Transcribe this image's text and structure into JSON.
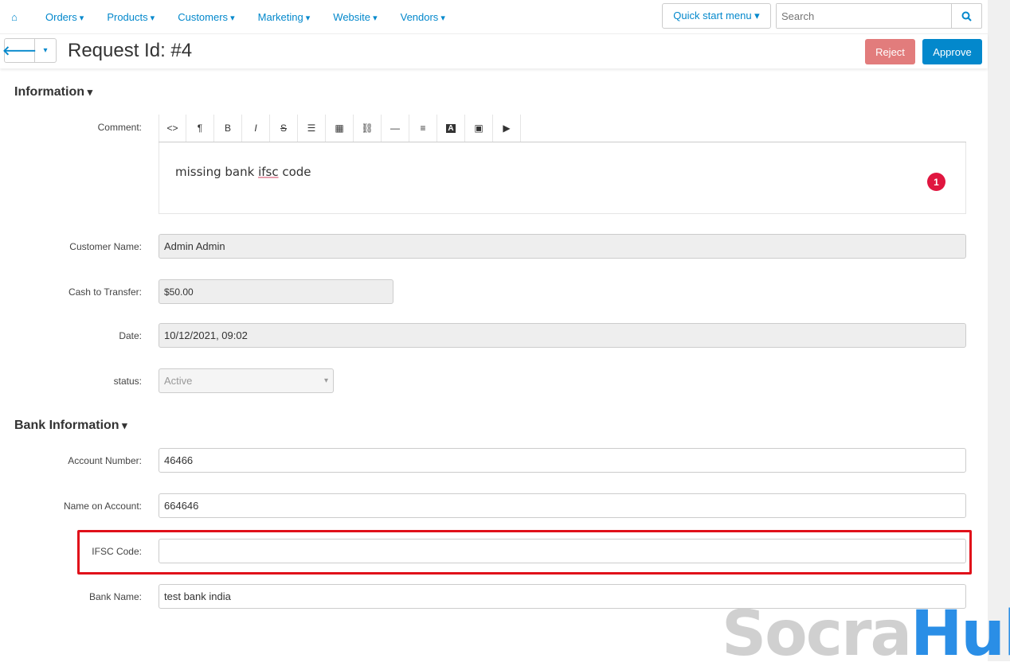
{
  "nav": {
    "items": [
      "Orders",
      "Products",
      "Customers",
      "Marketing",
      "Website",
      "Vendors"
    ],
    "quick_start": "Quick start menu ▾",
    "search_placeholder": "Search"
  },
  "header": {
    "title": "Request Id: #4",
    "reject": "Reject",
    "approve": "Approve"
  },
  "information": {
    "heading": "Information",
    "comment_label": "Comment:",
    "comment_pre": "missing bank ",
    "comment_misspelled": "ifsc",
    "comment_post": " code",
    "badge": "1",
    "customer_name_label": "Customer Name:",
    "customer_name": "Admin Admin",
    "cash_label": "Cash to Transfer:",
    "cash": "$50.00",
    "date_label": "Date:",
    "date": "10/12/2021, 09:02",
    "status_label": "status:",
    "status": "Active"
  },
  "bank": {
    "heading": "Bank Information",
    "account_label": "Account Number:",
    "account": "46466",
    "name_label": "Name on Account:",
    "name": "664646",
    "ifsc_label": "IFSC Code:",
    "ifsc": "",
    "bank_label": "Bank Name:",
    "bank_name": "test bank india"
  },
  "watermark": {
    "part1": "Socra",
    "part2": "Hub"
  },
  "colors": {
    "accent": "#0388cc",
    "reject": "#e27c7c",
    "highlight": "#e0101a"
  }
}
